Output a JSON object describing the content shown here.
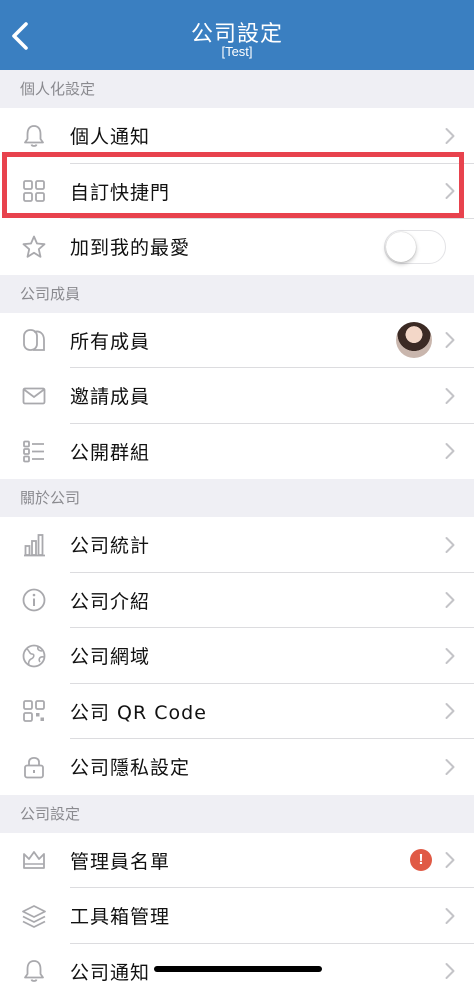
{
  "header": {
    "title": "公司設定",
    "subtitle": "[Test]",
    "background": "#3a7fc1"
  },
  "sections": [
    {
      "title": "個人化設定",
      "rows": [
        {
          "name": "personal-notification",
          "label": "個人通知",
          "icon": "bell-icon",
          "accessory": "chevron"
        },
        {
          "name": "custom-shortcut",
          "label": "自訂快捷門",
          "icon": "grid-icon",
          "accessory": "chevron",
          "highlighted": true
        },
        {
          "name": "add-to-favorites",
          "label": "加到我的最愛",
          "icon": "star-icon",
          "accessory": "toggle",
          "toggle_on": false
        }
      ]
    },
    {
      "title": "公司成員",
      "rows": [
        {
          "name": "all-members",
          "label": "所有成員",
          "icon": "members-icon",
          "accessory": "avatar-chevron"
        },
        {
          "name": "invite-members",
          "label": "邀請成員",
          "icon": "envelope-icon",
          "accessory": "chevron"
        },
        {
          "name": "public-groups",
          "label": "公開群組",
          "icon": "list-icon",
          "accessory": "chevron"
        }
      ]
    },
    {
      "title": "關於公司",
      "rows": [
        {
          "name": "company-stats",
          "label": "公司統計",
          "icon": "bar-chart-icon",
          "accessory": "chevron"
        },
        {
          "name": "company-intro",
          "label": "公司介紹",
          "icon": "info-icon",
          "accessory": "chevron"
        },
        {
          "name": "company-domain",
          "label": "公司網域",
          "icon": "globe-icon",
          "accessory": "chevron"
        },
        {
          "name": "company-qr-code",
          "label": "公司 QR Code",
          "icon": "qr-code-icon",
          "accessory": "chevron"
        },
        {
          "name": "company-privacy",
          "label": "公司隱私設定",
          "icon": "lock-icon",
          "accessory": "chevron"
        }
      ]
    },
    {
      "title": "公司設定",
      "rows": [
        {
          "name": "admin-list",
          "label": "管理員名單",
          "icon": "crown-icon",
          "accessory": "alert-chevron",
          "alert_text": "!"
        },
        {
          "name": "toolbox-management",
          "label": "工具箱管理",
          "icon": "layers-icon",
          "accessory": "chevron"
        },
        {
          "name": "company-notification",
          "label": "公司通知",
          "icon": "bell-icon",
          "accessory": "chevron"
        }
      ]
    }
  ],
  "colors": {
    "highlight_border": "#e8424d",
    "alert_badge": "#e05a45",
    "icon_gray": "#a9a9ad",
    "chevron_gray": "#c4c4c8"
  }
}
